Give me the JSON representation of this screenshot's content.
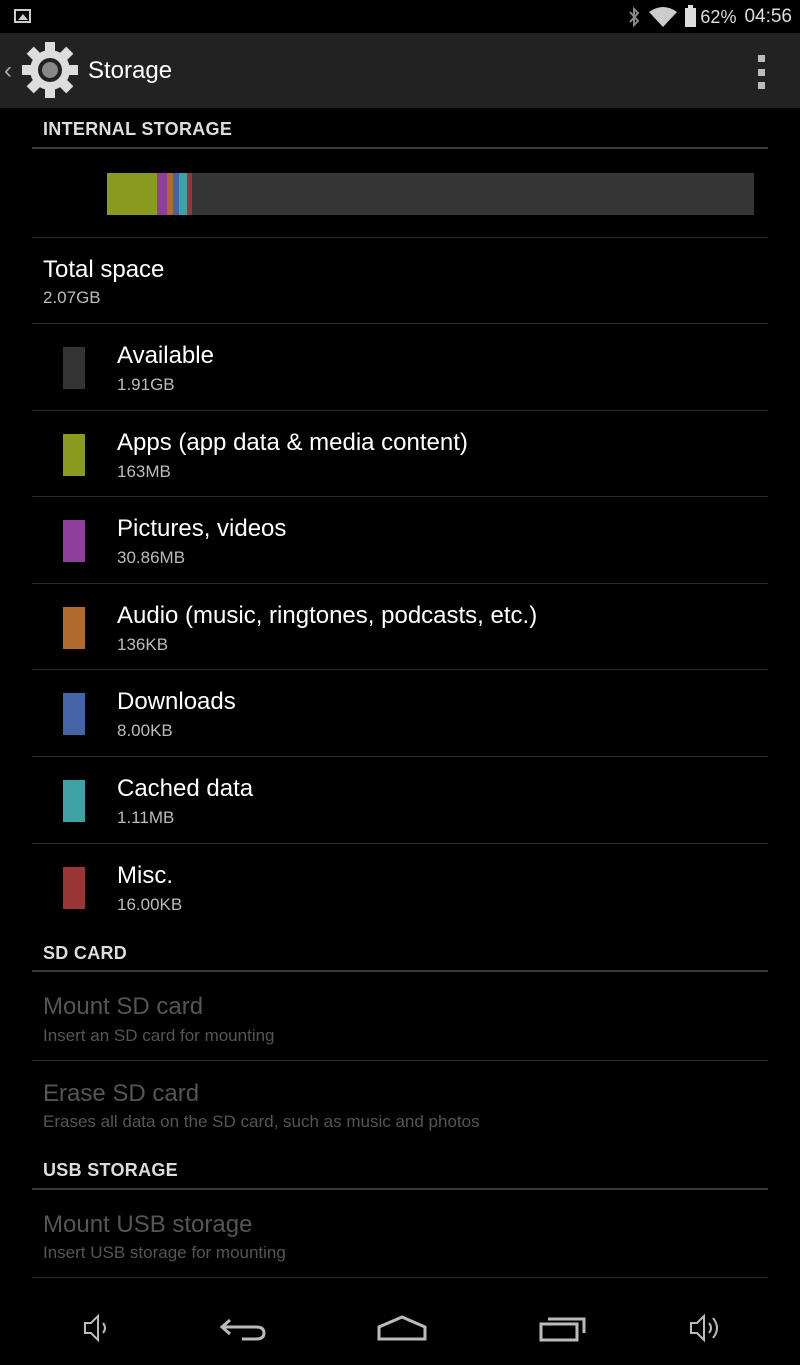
{
  "status_bar": {
    "battery_pct": "62%",
    "time": "04:56",
    "icons": [
      "image-notification-icon",
      "bluetooth-icon",
      "wifi-icon",
      "battery-icon"
    ]
  },
  "action_bar": {
    "title": "Storage",
    "icons": [
      "back-chevron-icon",
      "settings-gear-icon",
      "overflow-menu-icon"
    ]
  },
  "internal": {
    "header": "INTERNAL STORAGE",
    "usage_segments": [
      {
        "name": "apps",
        "color": "#8a9a1f",
        "fraction": 0.078
      },
      {
        "name": "pictures",
        "color": "#8e3f9b",
        "fraction": 0.015
      },
      {
        "name": "audio",
        "color": "#b06a2d",
        "fraction": 0.009
      },
      {
        "name": "downloads",
        "color": "#4464a8",
        "fraction": 0.009
      },
      {
        "name": "cached",
        "color": "#3fa3a6",
        "fraction": 0.012
      },
      {
        "name": "misc",
        "color": "#9a3535",
        "fraction": 0.009
      }
    ],
    "total": {
      "title": "Total space",
      "value": "2.07GB"
    },
    "items": [
      {
        "title": "Available",
        "value": "1.91GB",
        "color": "#333333"
      },
      {
        "title": "Apps (app data & media content)",
        "value": "163MB",
        "color": "#8a9a1f"
      },
      {
        "title": "Pictures, videos",
        "value": "30.86MB",
        "color": "#8e3f9b"
      },
      {
        "title": "Audio (music, ringtones, podcasts, etc.)",
        "value": "136KB",
        "color": "#b06a2d"
      },
      {
        "title": "Downloads",
        "value": "8.00KB",
        "color": "#4464a8"
      },
      {
        "title": "Cached data",
        "value": "1.11MB",
        "color": "#3fa3a6"
      },
      {
        "title": "Misc.",
        "value": "16.00KB",
        "color": "#9a3535"
      }
    ]
  },
  "sd": {
    "header": "SD CARD",
    "mount": {
      "title": "Mount SD card",
      "sub": "Insert an SD card for mounting"
    },
    "erase": {
      "title": "Erase SD card",
      "sub": "Erases all data on the SD card, such as music and photos"
    }
  },
  "usb": {
    "header": "USB STORAGE",
    "mount": {
      "title": "Mount USB storage",
      "sub": "Insert USB storage for mounting"
    }
  },
  "nav_bar": {
    "icons": [
      "volume-down-icon",
      "back-icon",
      "home-icon",
      "recent-apps-icon",
      "volume-up-icon"
    ]
  }
}
